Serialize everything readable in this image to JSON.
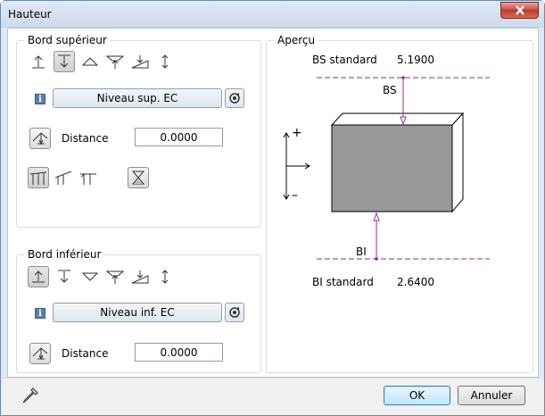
{
  "window": {
    "title": "Hauteur"
  },
  "bord_superieur": {
    "title": "Bord supérieur",
    "level_button": "Niveau sup. EC",
    "distance_label": "Distance",
    "distance_value": "0.0000"
  },
  "bord_inferieur": {
    "title": "Bord inférieur",
    "level_button": "Niveau inf. EC",
    "distance_label": "Distance",
    "distance_value": "0.0000"
  },
  "apercu": {
    "title": "Aperçu",
    "bs_standard_label": "BS standard",
    "bs_standard_value": "5.1900",
    "bs_marker": "BS",
    "bi_standard_label": "BI standard",
    "bi_standard_value": "2.6400",
    "bi_marker": "BI",
    "plus_sign": "+",
    "minus_sign": "–"
  },
  "footer": {
    "ok_label": "OK",
    "cancel_label": "Annuler"
  },
  "colors": {
    "accent_line": "#8b2b9b",
    "block_fill": "#999999",
    "icon_blue": "#5a7fa9"
  }
}
